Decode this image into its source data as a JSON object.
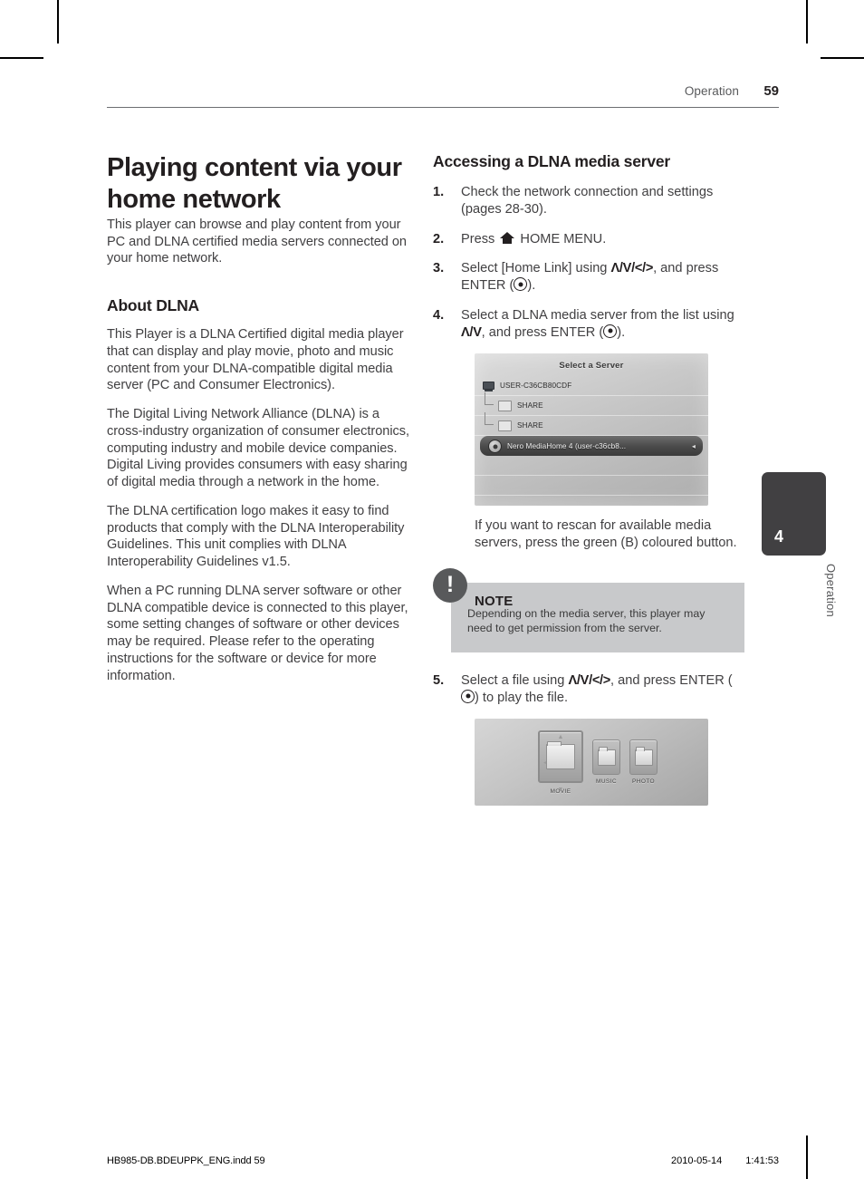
{
  "header": {
    "section": "Operation",
    "page_number": "59"
  },
  "left_column": {
    "title": "Playing content via your home network",
    "intro": "This player can browse and play content from your PC and DLNA certified media servers connected on your home network.",
    "about": {
      "heading": "About DLNA",
      "paragraphs": [
        "This Player is a DLNA Certified digital media player that can display and play movie, photo and music content from your DLNA-compatible digital media server (PC and Consumer Electronics).",
        "The Digital Living Network Alliance (DLNA) is a cross-industry organization of consumer electronics, computing industry and mobile device companies. Digital Living provides consumers with easy sharing of digital media through a network in the home.",
        "The DLNA certification logo makes it easy to find products that comply with the DLNA Interoperability Guidelines. This unit complies with DLNA Interoperability Guidelines v1.5.",
        "When a PC running DLNA server software or other DLNA compatible device is connected to this player, some setting changes of software or other devices may be required. Please refer to the operating instructions for the software or device for more information."
      ]
    }
  },
  "right_column": {
    "heading": "Accessing a DLNA media server",
    "steps": [
      {
        "num": "1.",
        "text_before": "Check the network connection and settings (pages 28-30).",
        "text_after": ""
      },
      {
        "num": "2.",
        "text_before": "Press ",
        "text_after": " HOME MENU."
      },
      {
        "num": "3.",
        "text_before": "Select [Home Link] using ",
        "keys": "Λ/V/</>",
        "text_mid": ", and press ENTER (",
        "text_after": ")."
      },
      {
        "num": "4.",
        "text_before": "Select a DLNA media server from the list using ",
        "keys": "Λ/V",
        "text_mid": ", and press ENTER (",
        "text_after": ")."
      },
      {
        "num": "5.",
        "text_before": "Select a file using ",
        "keys": "Λ/V/</>",
        "text_mid": ", and press ENTER (",
        "text_after": ") to play the file."
      }
    ],
    "rescan_caption": "If you want to rescan for available media servers, press the green (B) coloured button.",
    "note": {
      "title": "NOTE",
      "icon": "!",
      "text": "Depending on the media server, this player may need to get permission from the server."
    }
  },
  "server_screenshot": {
    "title": "Select a Server",
    "rows": [
      {
        "label": "USER-C36CB80CDF",
        "icon": "pc-icon",
        "indent": false,
        "selected": false,
        "badge": ""
      },
      {
        "label": "SHARE",
        "icon": "folder-icon",
        "indent": true,
        "selected": false,
        "badge": ""
      },
      {
        "label": "SHARE",
        "icon": "folder-icon",
        "indent": true,
        "selected": false,
        "badge": ""
      },
      {
        "label": "Nero MediaHome 4 (user-c36cb8...",
        "icon": "nero-icon",
        "indent": false,
        "selected": true,
        "badge": "◂"
      }
    ]
  },
  "media_screenshot": {
    "items": [
      {
        "label": "MOVIE",
        "icon": "folder-icon",
        "active": true
      },
      {
        "label": "MUSIC",
        "icon": "folder-icon",
        "active": false
      },
      {
        "label": "PHOTO",
        "icon": "folder-icon",
        "active": false
      }
    ]
  },
  "side_tab": {
    "number": "4",
    "label": "Operation"
  },
  "footer": {
    "filename": "HB985-DB.BDEUPPK_ENG.indd   59",
    "date": "2010-05-14",
    "time": "1:41:53"
  }
}
